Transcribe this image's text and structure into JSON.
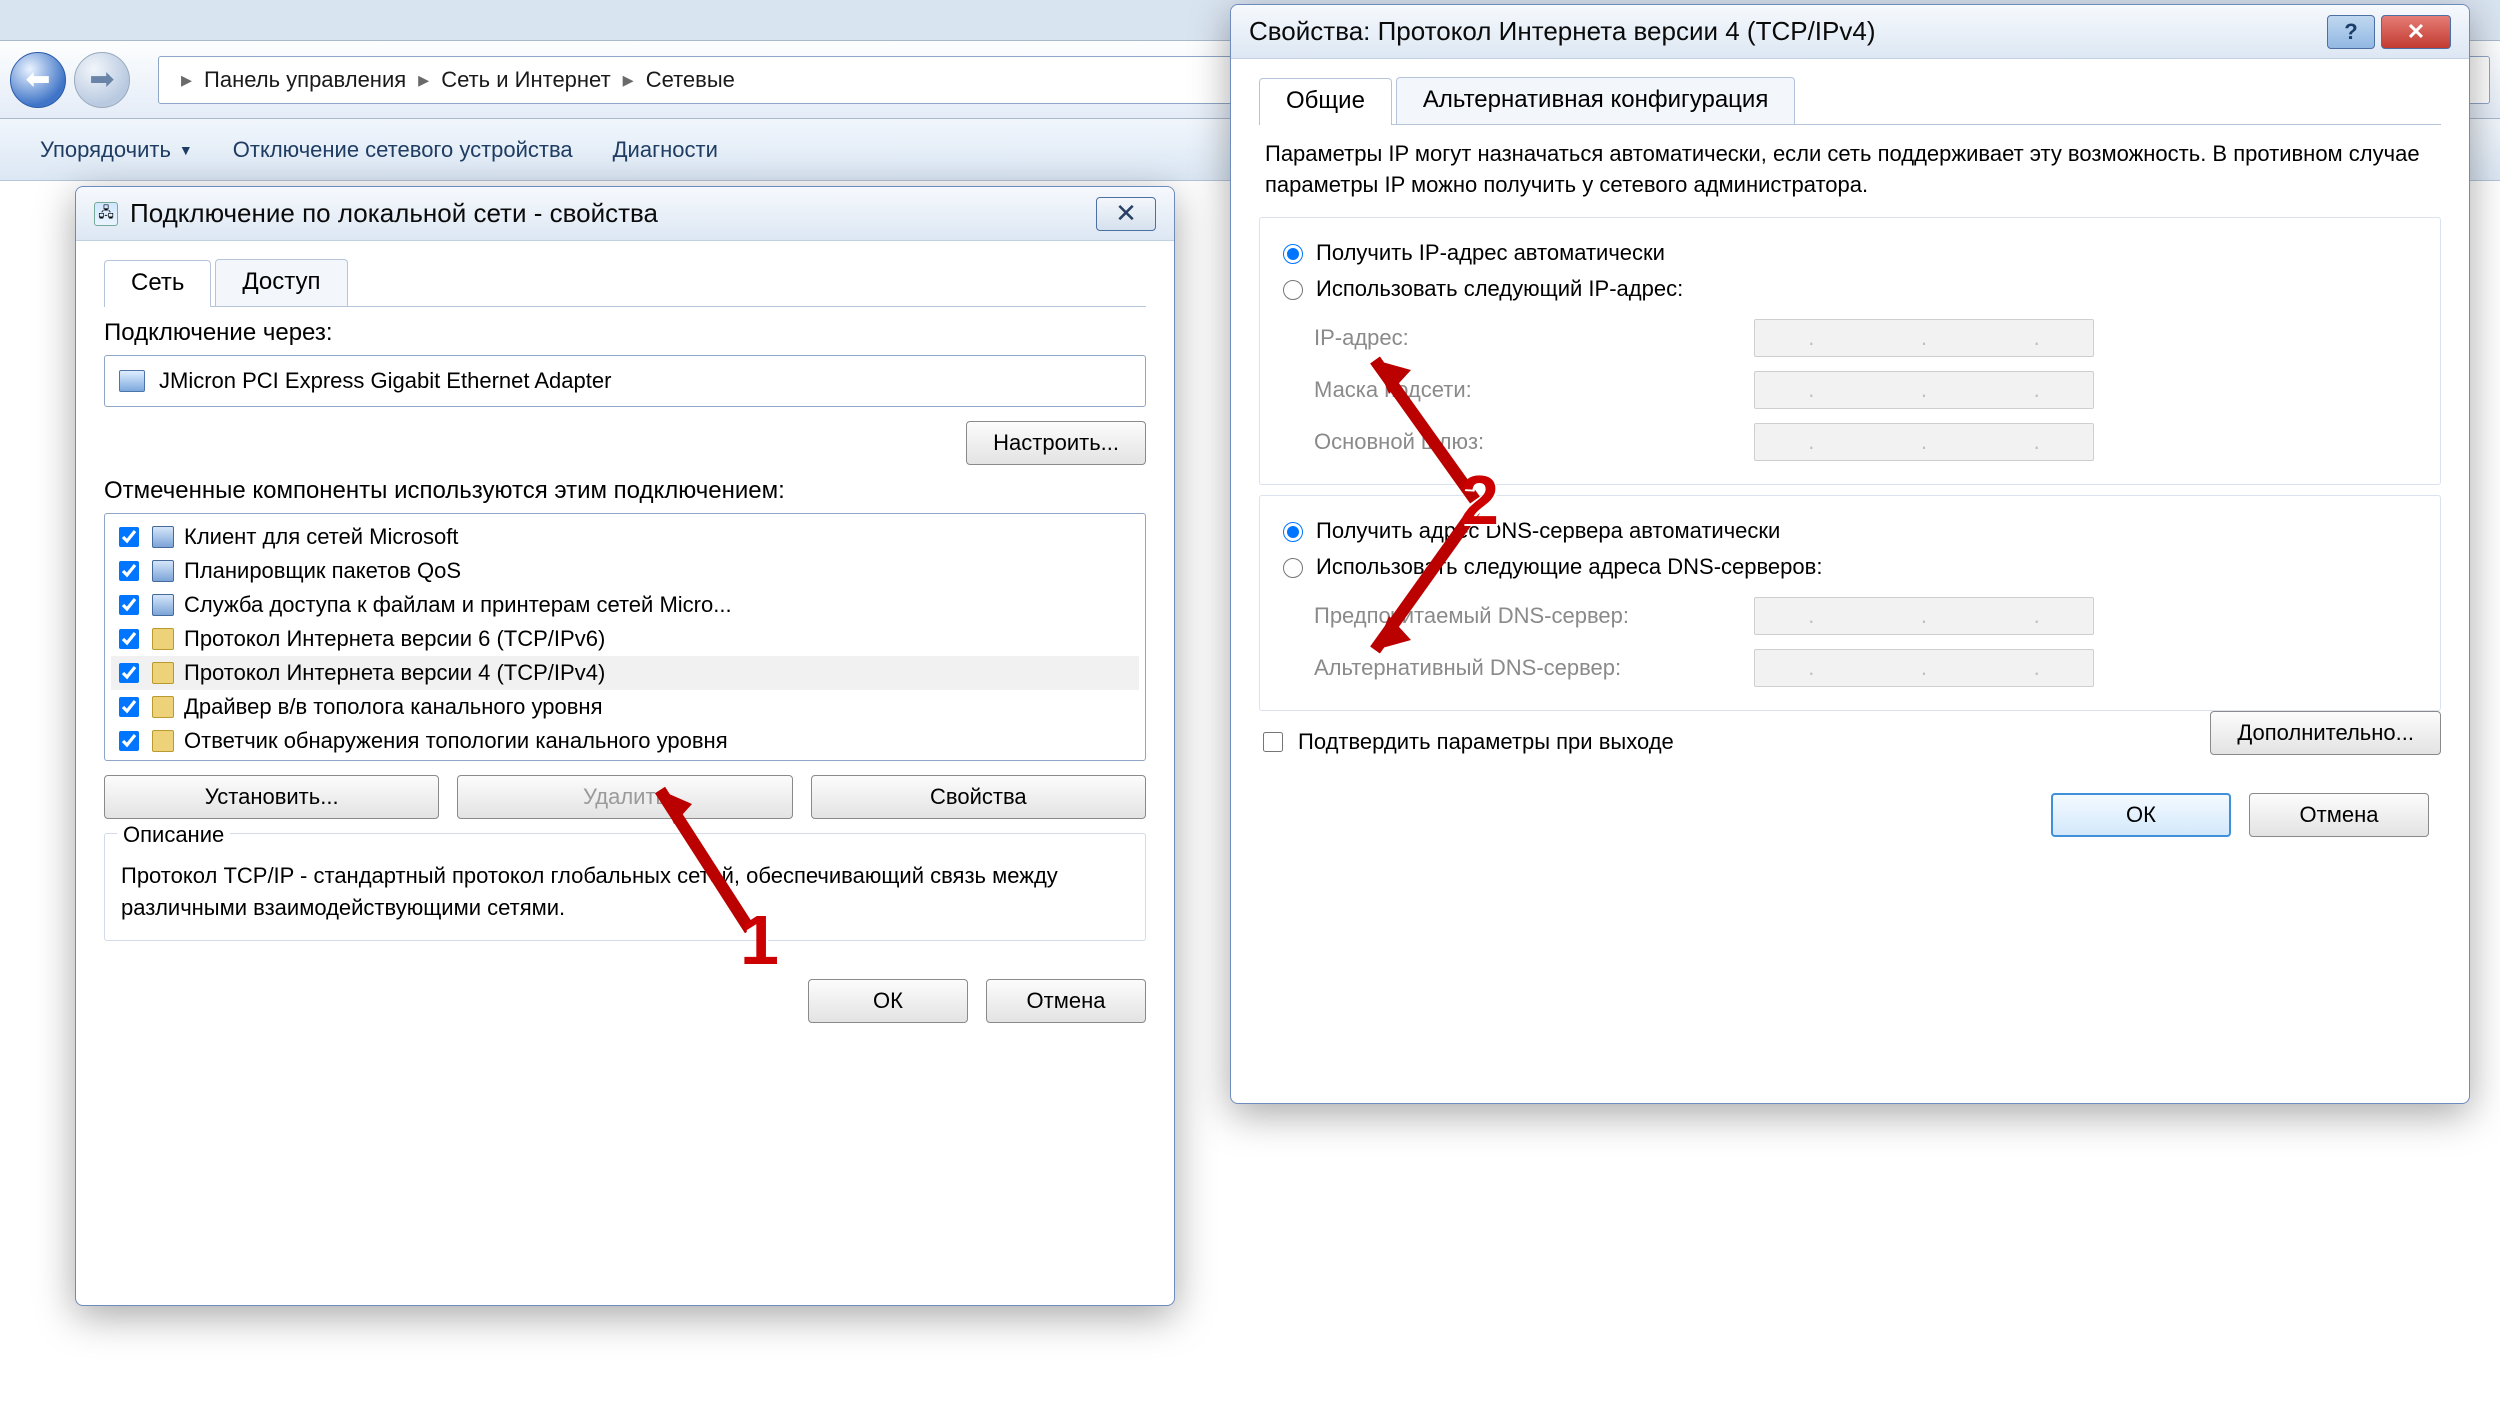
{
  "explorer": {
    "crumb1": "Панель управления",
    "crumb2": "Сеть и Интернет",
    "crumb3": "Сетевые",
    "toolbar": {
      "org": "Упорядочить",
      "disable": "Отключение сетевого устройства",
      "diag": "Диагности"
    }
  },
  "win_left": {
    "title": "Подключение по локальной сети - свойства",
    "tab_net": "Сеть",
    "tab_share": "Доступ",
    "connect_via": "Подключение через:",
    "adapter": "JMicron PCI Express Gigabit Ethernet Adapter",
    "configure": "Настроить...",
    "components_label": "Отмеченные компоненты используются этим подключением:",
    "components": [
      "Клиент для сетей Microsoft",
      "Планировщик пакетов QoS",
      "Служба доступа к файлам и принтерам сетей Micro...",
      "Протокол Интернета версии 6 (TCP/IPv6)",
      "Протокол Интернета версии 4 (TCP/IPv4)",
      "Драйвер в/в тополога канального уровня",
      "Ответчик обнаружения топологии канального уровня"
    ],
    "install": "Установить...",
    "remove": "Удалить",
    "props": "Свойства",
    "desc_label": "Описание",
    "desc_text": "Протокол TCP/IP - стандартный протокол глобальных сетей, обеспечивающий связь между различными взаимодействующими сетями.",
    "ok": "ОК",
    "cancel": "Отмена"
  },
  "win_right": {
    "title": "Свойства: Протокол Интернета версии 4 (TCP/IPv4)",
    "tab_general": "Общие",
    "tab_alt": "Альтернативная конфигурация",
    "intro": "Параметры IP могут назначаться автоматически, если сеть поддерживает эту возможность. В противном случае параметры IP можно получить у сетевого администратора.",
    "radio_ip_auto": "Получить IP-адрес автоматически",
    "radio_ip_manual": "Использовать следующий IP-адрес:",
    "ip_label": "IP-адрес:",
    "mask_label": "Маска подсети:",
    "gw_label": "Основной шлюз:",
    "radio_dns_auto": "Получить адрес DNS-сервера автоматически",
    "radio_dns_manual": "Использовать следующие адреса DNS-серверов:",
    "pref_dns": "Предпочитаемый DNS-сервер:",
    "alt_dns": "Альтернативный DNS-сервер:",
    "confirm": "Подтвердить параметры при выходе",
    "advanced": "Дополнительно...",
    "ok": "ОК",
    "cancel": "Отмена"
  },
  "annotations": {
    "num1": "1",
    "num2": "2"
  }
}
